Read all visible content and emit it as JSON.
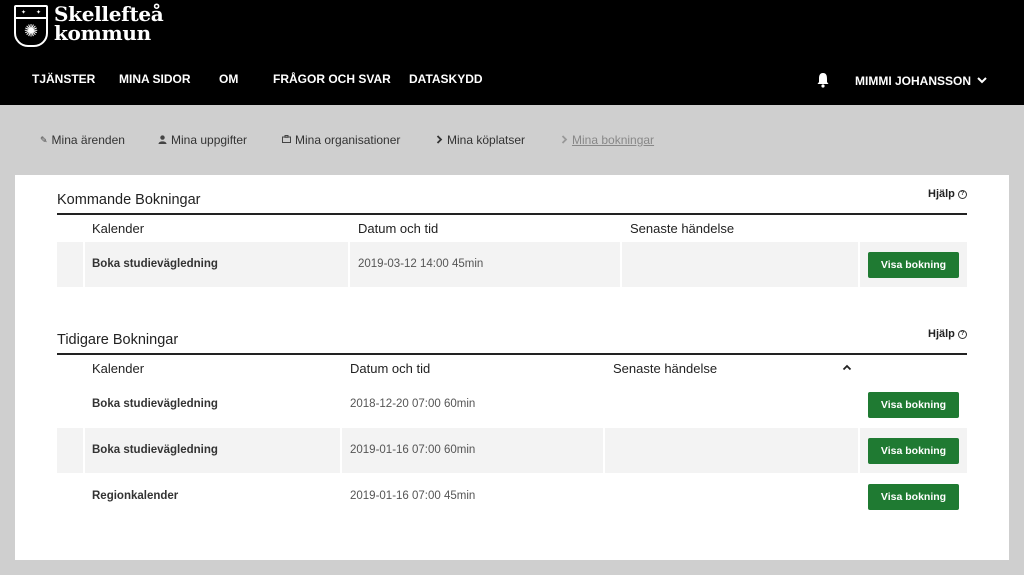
{
  "logo": {
    "line1": "Skellefteå",
    "line2": "kommun"
  },
  "nav": {
    "items": [
      "Tjänster",
      "Mina sidor",
      "Om",
      "Frågor och svar",
      "Dataskydd"
    ],
    "user": "MIMMI JOHANSSON"
  },
  "subnav": {
    "items": [
      "Mina ärenden",
      "Mina uppgifter",
      "Mina organisationer",
      "Mina köplatser",
      "Mina bokningar"
    ],
    "active": "Mina bokningar"
  },
  "upcoming": {
    "title": "Kommande Bokningar",
    "help": "Hjälp",
    "columns": [
      "Kalender",
      "Datum och tid",
      "Senaste händelse"
    ],
    "rows": [
      {
        "calendar": "Boka studievägledning",
        "datetime": "2019-03-12 14:00 45min",
        "event": "",
        "button": "Visa bokning"
      }
    ]
  },
  "previous": {
    "title": "Tidigare Bokningar",
    "help": "Hjälp",
    "columns": [
      "Kalender",
      "Datum och tid",
      "Senaste händelse"
    ],
    "rows": [
      {
        "calendar": "Boka studievägledning",
        "datetime": "2018-12-20 07:00 60min",
        "event": "",
        "button": "Visa bokning"
      },
      {
        "calendar": "Boka studievägledning",
        "datetime": "2019-01-16 07:00 60min",
        "event": "",
        "button": "Visa bokning"
      },
      {
        "calendar": "Regionkalender",
        "datetime": "2019-01-16 07:00 45min",
        "event": "",
        "button": "Visa bokning"
      }
    ]
  },
  "colors": {
    "topbar": "#000000",
    "button": "#1f7a32",
    "background": "#cfcfcf"
  },
  "icons": [
    "crest-logo",
    "bell-icon",
    "chevron-down-icon",
    "pencil-icon",
    "person-icon",
    "briefcase-icon",
    "chevron-right-icon",
    "help-circle-icon",
    "sort-up-icon"
  ]
}
